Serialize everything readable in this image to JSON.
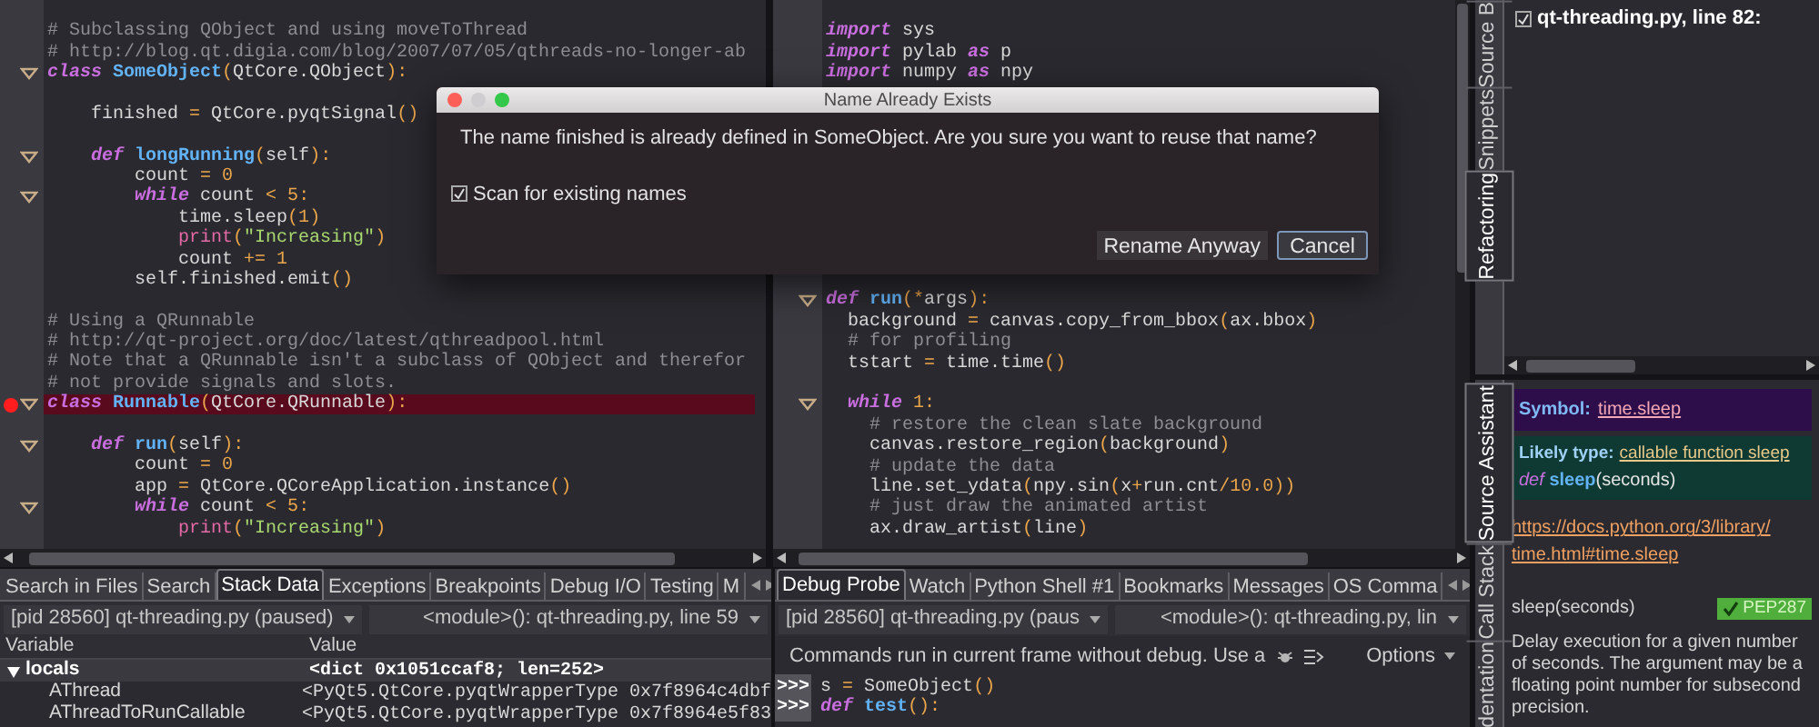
{
  "left_editor": {
    "lines": [
      {
        "kind": "plain",
        "tokens": [
          {
            "kind": "comment",
            "text": "# Subclassing QObject and using moveToThread"
          }
        ]
      },
      {
        "kind": "plain",
        "tokens": [
          {
            "kind": "comment",
            "text": "# http://blog.qt.digia.com/blog/2007/07/05/qthreads-no-longer-ab"
          }
        ]
      },
      {
        "kind": "fold",
        "tokens": [
          {
            "kind": "keyword",
            "text": "class"
          },
          {
            "kind": "name",
            "text": " SomeObject"
          },
          {
            "kind": "punct",
            "text": "("
          },
          {
            "kind": "plain",
            "text": "QtCore.QObject"
          },
          {
            "kind": "punct",
            "text": "):"
          }
        ]
      },
      {
        "kind": "plain"
      },
      {
        "kind": "plain",
        "tokens": [
          {
            "kind": "plain",
            "text": "    finished "
          },
          {
            "kind": "punct",
            "text": "="
          },
          {
            "kind": "plain",
            "text": " QtCore.pyqtSignal"
          },
          {
            "kind": "punct",
            "text": "()"
          }
        ]
      },
      {
        "kind": "plain"
      },
      {
        "kind": "fold",
        "tokens": [
          {
            "kind": "keyword",
            "text": "    def"
          },
          {
            "kind": "name",
            "text": " longRunning"
          },
          {
            "kind": "punct",
            "text": "("
          },
          {
            "kind": "plain",
            "text": "self"
          },
          {
            "kind": "punct",
            "text": "):"
          }
        ]
      },
      {
        "kind": "plain",
        "tokens": [
          {
            "kind": "plain",
            "text": "        count "
          },
          {
            "kind": "punct",
            "text": "="
          },
          {
            "kind": "number",
            "text": " 0"
          }
        ]
      },
      {
        "kind": "fold",
        "tokens": [
          {
            "kind": "keyword",
            "text": "        while"
          },
          {
            "kind": "plain",
            "text": " count "
          },
          {
            "kind": "punct",
            "text": "<"
          },
          {
            "kind": "number",
            "text": " 5"
          },
          {
            "kind": "punct",
            "text": ":"
          }
        ]
      },
      {
        "kind": "plain",
        "tokens": [
          {
            "kind": "plain",
            "text": "            time.sleep"
          },
          {
            "kind": "punct",
            "text": "("
          },
          {
            "kind": "number",
            "text": "1"
          },
          {
            "kind": "punct",
            "text": ")"
          }
        ]
      },
      {
        "kind": "plain",
        "tokens": [
          {
            "kind": "builtin",
            "text": "            print"
          },
          {
            "kind": "punct",
            "text": "("
          },
          {
            "kind": "string",
            "text": "\"Increasing\""
          },
          {
            "kind": "punct",
            "text": ")"
          }
        ]
      },
      {
        "kind": "plain",
        "tokens": [
          {
            "kind": "plain",
            "text": "            count "
          },
          {
            "kind": "punct",
            "text": "+="
          },
          {
            "kind": "number",
            "text": " 1"
          }
        ]
      },
      {
        "kind": "plain",
        "tokens": [
          {
            "kind": "plain",
            "text": "        self.finished.emit"
          },
          {
            "kind": "punct",
            "text": "()"
          }
        ]
      },
      {
        "kind": "plain"
      },
      {
        "kind": "plain",
        "tokens": [
          {
            "kind": "comment",
            "text": "# Using a QRunnable"
          }
        ]
      },
      {
        "kind": "plain",
        "tokens": [
          {
            "kind": "comment",
            "text": "# http://qt-project.org/doc/latest/qthreadpool.html"
          }
        ]
      },
      {
        "kind": "plain",
        "tokens": [
          {
            "kind": "comment",
            "text": "# Note that a QRunnable isn't a subclass of QObject and therefor"
          }
        ]
      },
      {
        "kind": "plain",
        "tokens": [
          {
            "kind": "comment",
            "text": "# not provide signals and slots."
          }
        ]
      },
      {
        "kind": "breakpoint",
        "tokens": [
          {
            "kind": "keyword",
            "text": "class"
          },
          {
            "kind": "name",
            "text": " Runnable"
          },
          {
            "kind": "punct",
            "text": "("
          },
          {
            "kind": "plain",
            "text": "QtCore.QRunnable"
          },
          {
            "kind": "punct",
            "text": "):"
          }
        ]
      },
      {
        "kind": "plain"
      },
      {
        "kind": "fold",
        "tokens": [
          {
            "kind": "keyword",
            "text": "    def"
          },
          {
            "kind": "name",
            "text": " run"
          },
          {
            "kind": "punct",
            "text": "("
          },
          {
            "kind": "plain",
            "text": "self"
          },
          {
            "kind": "punct",
            "text": "):"
          }
        ]
      },
      {
        "kind": "plain",
        "tokens": [
          {
            "kind": "plain",
            "text": "        count "
          },
          {
            "kind": "punct",
            "text": "="
          },
          {
            "kind": "number",
            "text": " 0"
          }
        ]
      },
      {
        "kind": "plain",
        "tokens": [
          {
            "kind": "plain",
            "text": "        app "
          },
          {
            "kind": "punct",
            "text": "="
          },
          {
            "kind": "plain",
            "text": " QtCore.QCoreApplication.instance"
          },
          {
            "kind": "punct",
            "text": "()"
          }
        ]
      },
      {
        "kind": "fold",
        "tokens": [
          {
            "kind": "keyword",
            "text": "        while"
          },
          {
            "kind": "plain",
            "text": " count "
          },
          {
            "kind": "punct",
            "text": "<"
          },
          {
            "kind": "number",
            "text": " 5"
          },
          {
            "kind": "punct",
            "text": ":"
          }
        ]
      },
      {
        "kind": "plain",
        "tokens": [
          {
            "kind": "builtin",
            "text": "            print"
          },
          {
            "kind": "punct",
            "text": "("
          },
          {
            "kind": "string",
            "text": "\"Increasing\""
          },
          {
            "kind": "punct",
            "text": ")"
          }
        ]
      }
    ]
  },
  "right_editor": {
    "top_lines": [
      {
        "tokens": [
          {
            "kind": "keyword",
            "text": "import"
          },
          {
            "kind": "plain",
            "text": " sys"
          }
        ]
      },
      {
        "tokens": [
          {
            "kind": "keyword",
            "text": "import"
          },
          {
            "kind": "plain",
            "text": " pylab "
          },
          {
            "kind": "keyword",
            "text": "as"
          },
          {
            "kind": "plain",
            "text": " p"
          }
        ]
      },
      {
        "tokens": [
          {
            "kind": "keyword",
            "text": "import"
          },
          {
            "kind": "plain",
            "text": " numpy "
          },
          {
            "kind": "keyword",
            "text": "as"
          },
          {
            "kind": "plain",
            "text": " npy"
          }
        ]
      }
    ],
    "lines": [
      {
        "kind": "fold",
        "tokens": [
          {
            "kind": "keyword",
            "text": "def"
          },
          {
            "kind": "name",
            "text": " run"
          },
          {
            "kind": "punct",
            "text": "(*"
          },
          {
            "kind": "plain",
            "text": "args"
          },
          {
            "kind": "punct",
            "text": "):"
          }
        ]
      },
      {
        "kind": "plain",
        "tokens": [
          {
            "kind": "plain",
            "text": "  background "
          },
          {
            "kind": "punct",
            "text": "="
          },
          {
            "kind": "plain",
            "text": " canvas.copy_from_bbox"
          },
          {
            "kind": "punct",
            "text": "("
          },
          {
            "kind": "plain",
            "text": "ax.bbox"
          },
          {
            "kind": "punct",
            "text": ")"
          }
        ]
      },
      {
        "kind": "plain",
        "tokens": [
          {
            "kind": "comment",
            "text": "  # for profiling"
          }
        ]
      },
      {
        "kind": "plain",
        "tokens": [
          {
            "kind": "plain",
            "text": "  tstart "
          },
          {
            "kind": "punct",
            "text": "="
          },
          {
            "kind": "plain",
            "text": " time.time"
          },
          {
            "kind": "punct",
            "text": "()"
          }
        ]
      },
      {
        "kind": "plain"
      },
      {
        "kind": "fold",
        "tokens": [
          {
            "kind": "keyword",
            "text": "  while"
          },
          {
            "kind": "number",
            "text": " 1"
          },
          {
            "kind": "punct",
            "text": ":"
          }
        ]
      },
      {
        "kind": "plain",
        "tokens": [
          {
            "kind": "comment",
            "text": "    # restore the clean slate background"
          }
        ]
      },
      {
        "kind": "plain",
        "tokens": [
          {
            "kind": "plain",
            "text": "    canvas.restore_region"
          },
          {
            "kind": "punct",
            "text": "("
          },
          {
            "kind": "plain",
            "text": "background"
          },
          {
            "kind": "punct",
            "text": ")"
          }
        ]
      },
      {
        "kind": "plain",
        "tokens": [
          {
            "kind": "comment",
            "text": "    # update the data"
          }
        ]
      },
      {
        "kind": "plain",
        "tokens": [
          {
            "kind": "plain",
            "text": "    line.set_ydata"
          },
          {
            "kind": "punct",
            "text": "("
          },
          {
            "kind": "plain",
            "text": "npy.sin"
          },
          {
            "kind": "punct",
            "text": "("
          },
          {
            "kind": "plain",
            "text": "x"
          },
          {
            "kind": "punct",
            "text": "+"
          },
          {
            "kind": "plain",
            "text": "run.cnt"
          },
          {
            "kind": "punct",
            "text": "/"
          },
          {
            "kind": "number",
            "text": "10.0"
          },
          {
            "kind": "punct",
            "text": "))"
          }
        ]
      },
      {
        "kind": "plain",
        "tokens": [
          {
            "kind": "comment",
            "text": "    # just draw the animated artist"
          }
        ]
      },
      {
        "kind": "plain",
        "tokens": [
          {
            "kind": "plain",
            "text": "    ax.draw_artist"
          },
          {
            "kind": "punct",
            "text": "("
          },
          {
            "kind": "plain",
            "text": "line"
          },
          {
            "kind": "punct",
            "text": ")"
          }
        ]
      }
    ]
  },
  "dialog": {
    "title": "Name Already Exists",
    "message": "The name finished is already defined in SomeObject. Are you sure you want to reuse that name?",
    "checkbox": {
      "label": "Scan for existing names",
      "checked": true
    },
    "buttons": [
      {
        "label": "Rename Anyway",
        "default": false
      },
      {
        "label": "Cancel",
        "default": true
      }
    ]
  },
  "stack_panel": {
    "tabs": [
      {
        "label": "Search in Files",
        "selected": false
      },
      {
        "label": "Search",
        "selected": false
      },
      {
        "label": "Stack Data",
        "selected": true
      },
      {
        "label": "Exceptions",
        "selected": false
      },
      {
        "label": "Breakpoints",
        "selected": false
      },
      {
        "label": "Debug I/O",
        "selected": false
      },
      {
        "label": "Testing",
        "selected": false
      },
      {
        "label": "M",
        "selected": false
      }
    ],
    "process": "[pid 28560] qt-threading.py (paused)",
    "frame": "<module>(): qt-threading.py, line 59",
    "columns": [
      "Variable",
      "Value"
    ],
    "rows": [
      {
        "name": "locals",
        "value": "<dict 0x1051ccaf8; len=252>",
        "expanded": true,
        "children": [
          {
            "name": "AThread",
            "value": "<PyQt5.QtCore.pyqtWrapperType 0x7f8964c4dbf"
          },
          {
            "name": "AThreadToRunCallable",
            "value": "<PyQt5.QtCore.pyqtWrapperType 0x7f8964e5f83"
          }
        ]
      }
    ]
  },
  "probe_panel": {
    "tabs": [
      {
        "label": "Debug Probe",
        "selected": true
      },
      {
        "label": "Watch",
        "selected": false
      },
      {
        "label": "Python Shell #1",
        "selected": false
      },
      {
        "label": "Bookmarks",
        "selected": false
      },
      {
        "label": "Messages",
        "selected": false
      },
      {
        "label": "OS Comma",
        "selected": false
      }
    ],
    "process": "[pid 28560] qt-threading.py (paus",
    "frame": "<module>(): qt-threading.py, lin",
    "hint": "Commands run in current frame without debug. Use a",
    "options": "Options",
    "console": [
      {
        "prompt": ">>>",
        "tokens": [
          {
            "kind": "plain",
            "text": "s "
          },
          {
            "kind": "punct",
            "text": "="
          },
          {
            "kind": "plain",
            "text": " SomeObject"
          },
          {
            "kind": "punct",
            "text": "()"
          }
        ]
      },
      {
        "prompt": ">>>",
        "tokens": [
          {
            "kind": "keyword",
            "text": "def"
          },
          {
            "kind": "name",
            "text": " test"
          },
          {
            "kind": "punct",
            "text": "():"
          }
        ]
      }
    ]
  },
  "refactoring_panel": {
    "tabs": [
      {
        "label": "Source B",
        "selected": false
      },
      {
        "label": "Snippets",
        "selected": false
      },
      {
        "label": "Refactoring",
        "selected": true
      }
    ],
    "items": [
      {
        "label": "qt-threading.py, line 82:",
        "checked": true
      }
    ]
  },
  "assistant_panel": {
    "tabs": [
      {
        "label": "Source Assistant",
        "selected": true
      },
      {
        "label": "Call Stack",
        "selected": false
      },
      {
        "label": "dentation",
        "selected": false
      }
    ],
    "symbol_label": "Symbol:",
    "symbol": "time.sleep",
    "type_label": "Likely type:",
    "type": "callable function sleep",
    "signature": {
      "keyword": "def",
      "name": "sleep",
      "args": "(seconds)"
    },
    "link": "https://docs.python.org/3/library/time.html#time.sleep",
    "heading": "sleep(seconds)",
    "badge": "PEP287",
    "description": "Delay execution for a given number of seconds. The argument may be a floating point number for subsecond precision."
  }
}
